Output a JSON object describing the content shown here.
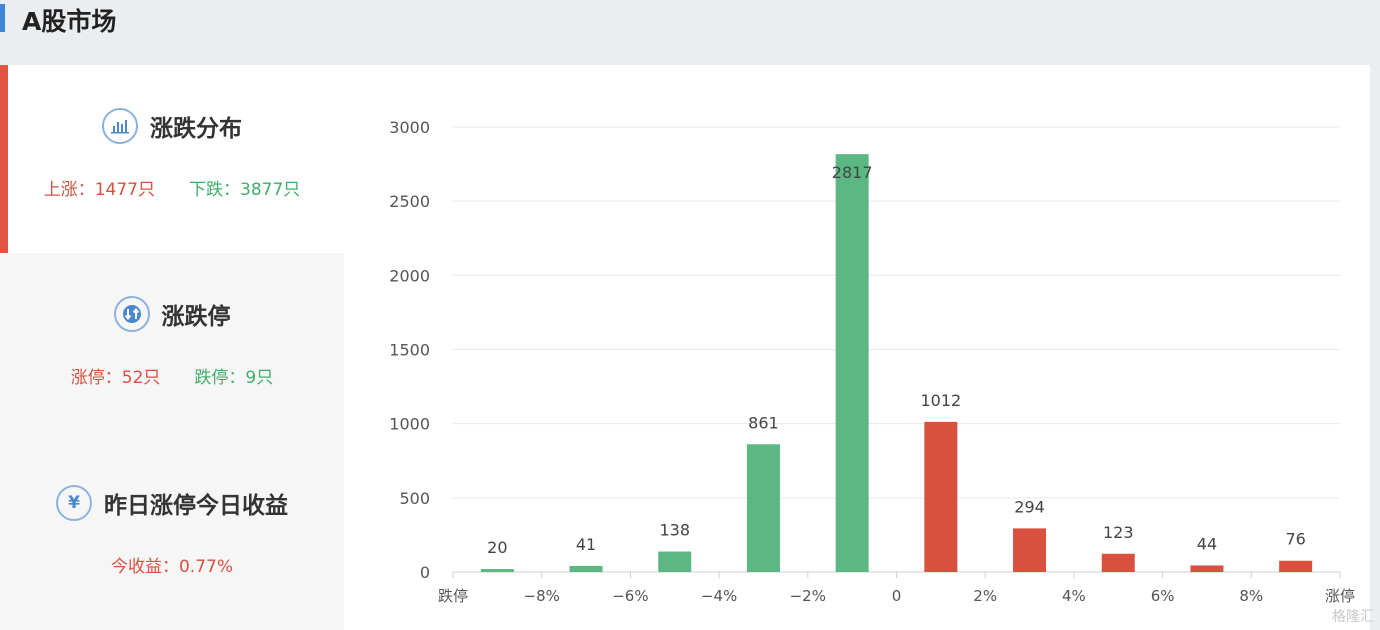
{
  "section_title": "A股市场",
  "sidebar": {
    "items": [
      {
        "label": "涨跌分布",
        "icon": "bar-chart-icon",
        "stat_left": "上涨：1477只",
        "stat_right": "下跌：3877只"
      },
      {
        "label": "涨跌停",
        "icon": "up-down-arrows-icon",
        "stat_left": "涨停：52只",
        "stat_right": "跌停：9只"
      },
      {
        "label": "昨日涨停今日收益",
        "icon": "yen-icon",
        "stat_left": "今收益：0.77%"
      }
    ]
  },
  "colors": {
    "up": "#d9503f",
    "down": "#5bb882",
    "accent": "#3e87d8"
  },
  "chart_data": {
    "type": "bar",
    "categories": [
      "跌停",
      "−8%",
      "−6%",
      "−4%",
      "−2%",
      "0",
      "2%",
      "4%",
      "6%",
      "8%",
      "涨停"
    ],
    "bars": [
      {
        "value": 20,
        "color": "down"
      },
      {
        "value": 41,
        "color": "down"
      },
      {
        "value": 138,
        "color": "down"
      },
      {
        "value": 861,
        "color": "down"
      },
      {
        "value": 2817,
        "color": "down"
      },
      {
        "value": 1012,
        "color": "up"
      },
      {
        "value": 294,
        "color": "up"
      },
      {
        "value": 123,
        "color": "up"
      },
      {
        "value": 44,
        "color": "up"
      },
      {
        "value": 76,
        "color": "up"
      }
    ],
    "yticks": [
      0,
      500,
      1000,
      1500,
      2000,
      2500,
      3000
    ],
    "ylim": [
      0,
      3000
    ],
    "grid": true
  },
  "watermark": "格隆汇"
}
